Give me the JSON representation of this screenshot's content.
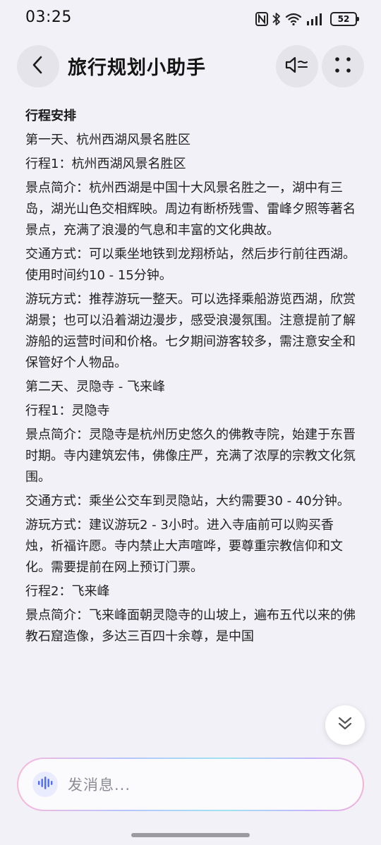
{
  "status_bar": {
    "time": "03:25",
    "battery": "52",
    "icons": [
      "nfc-icon",
      "bluetooth-icon",
      "wifi-icon",
      "signal-icon",
      "battery-icon"
    ]
  },
  "header": {
    "title": "旅行规划小助手",
    "back_icon": "chevron-left-icon",
    "voice_icon": "speaker-mute-icon",
    "more_icon": "grid-dots-icon"
  },
  "content": {
    "faded_top_line": "",
    "paragraphs": [
      {
        "kind": "heading",
        "text": "行程安排"
      },
      {
        "kind": "text",
        "text": "第一天、杭州西湖风景名胜区"
      },
      {
        "kind": "text",
        "text": "行程1：杭州西湖风景名胜区"
      },
      {
        "kind": "text",
        "text": "景点简介：杭州西湖是中国十大风景名胜之一，湖中有三岛，湖光山色交相辉映。周边有断桥残雪、雷峰夕照等著名景点，充满了浪漫的气息和丰富的文化典故。"
      },
      {
        "kind": "text",
        "text": "交通方式：可以乘坐地铁到龙翔桥站，然后步行前往西湖。使用时间约10 - 15分钟。"
      },
      {
        "kind": "text",
        "text": "游玩方式：推荐游玩一整天。可以选择乘船游览西湖，欣赏湖景；也可以沿着湖边漫步，感受浪漫氛围。注意提前了解游船的运营时间和价格。七夕期间游客较多，需注意安全和保管好个人物品。"
      },
      {
        "kind": "text",
        "text": "第二天、灵隐寺 - 飞来峰"
      },
      {
        "kind": "text",
        "text": "行程1：灵隐寺"
      },
      {
        "kind": "text",
        "text": "景点简介：灵隐寺是杭州历史悠久的佛教寺院，始建于东晋时期。寺内建筑宏伟，佛像庄严，充满了浓厚的宗教文化氛围。"
      },
      {
        "kind": "text",
        "text": "交通方式：乘坐公交车到灵隐站，大约需要30 - 40分钟。"
      },
      {
        "kind": "text",
        "text": "游玩方式：建议游玩2 - 3小时。进入寺庙前可以购买香烛，祈福许愿。寺内禁止大声喧哗，要尊重宗教信仰和文化。需要提前在网上预订门票。"
      },
      {
        "kind": "text",
        "text": "行程2：飞来峰"
      },
      {
        "kind": "text",
        "text": "景点简介：飞来峰面朝灵隐寺的山坡上，遍布五代以来的佛教石窟造像，多达三百四十余尊，是中国"
      }
    ]
  },
  "scroll_button": {
    "icon": "double-chevron-down-icon"
  },
  "input": {
    "placeholder": "发消息...",
    "icon": "voice-wave-icon"
  },
  "colors": {
    "background": "#f1f1f7",
    "button_bg": "#e4e4ea",
    "text": "#222222",
    "placeholder": "#8d8d95",
    "accent": "#4f6bff"
  }
}
